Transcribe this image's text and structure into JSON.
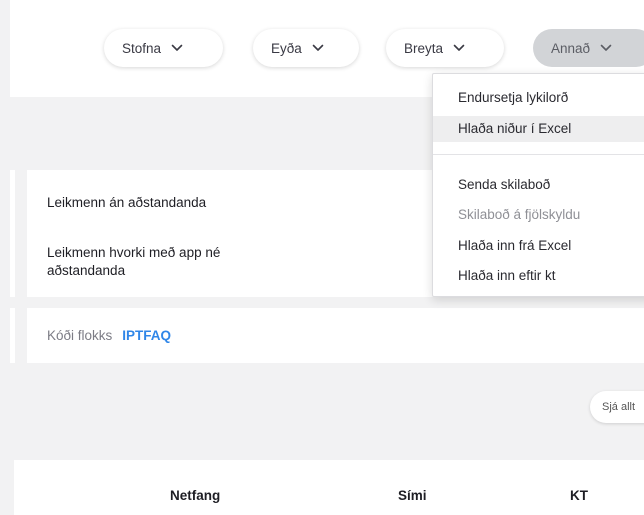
{
  "toolbar": {
    "create_label": "Stofna",
    "delete_label": "Eyða",
    "edit_label": "Breyta",
    "other_label": "Annað"
  },
  "dropdown": {
    "items": [
      {
        "label": "Endursetja lykilorð"
      },
      {
        "label": "Hlaða niður í Excel"
      },
      {
        "label": "Senda skilaboð"
      },
      {
        "label": "Skilaboð á fjölskyldu"
      },
      {
        "label": "Hlaða inn frá Excel"
      },
      {
        "label": "Hlaða inn eftir kt"
      }
    ]
  },
  "info": {
    "no_guardian": "Leikmenn án aðstandanda",
    "no_app_no_guardian": "Leikmenn hvorki með app né aðstandanda",
    "group_code_label": "Kóði flokks",
    "group_code_value": "IPTFAQ"
  },
  "see_all_label": "Sjá allt",
  "table": {
    "headers": {
      "email": "Netfang",
      "phone": "Sími",
      "kt": "KT"
    }
  }
}
